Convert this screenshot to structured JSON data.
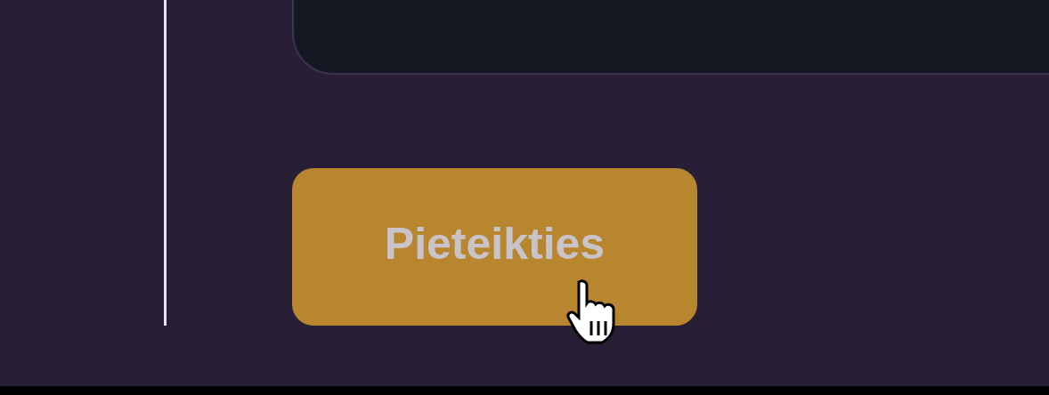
{
  "button": {
    "label": "Pieteikties"
  }
}
